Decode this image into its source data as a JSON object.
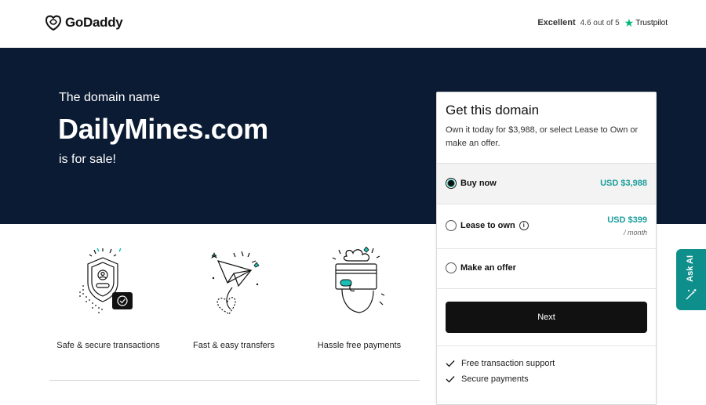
{
  "header": {
    "brand": "GoDaddy",
    "rating_word": "Excellent",
    "rating_score": "4.6 out of 5",
    "rating_provider": "Trustpilot"
  },
  "hero": {
    "pre": "The domain name",
    "domain": "DailyMines.com",
    "post": "is for sale!"
  },
  "features": [
    {
      "label": "Safe & secure transactions",
      "icon": "shield-icon"
    },
    {
      "label": "Fast & easy transfers",
      "icon": "paper-plane-icon"
    },
    {
      "label": "Hassle free payments",
      "icon": "credit-card-icon"
    }
  ],
  "card": {
    "title": "Get this domain",
    "description": "Own it today for $3,988, or select Lease to Own or make an offer.",
    "options": {
      "buy": {
        "label": "Buy now",
        "price": "USD $3,988",
        "selected": true
      },
      "lease": {
        "label": "Lease to own",
        "price": "USD $399",
        "period": "/ month"
      },
      "offer": {
        "label": "Make an offer"
      }
    },
    "next_label": "Next",
    "benefits": [
      "Free transaction support",
      "Secure payments"
    ]
  },
  "ask_ai": {
    "label": "Ask AI"
  },
  "colors": {
    "hero_bg": "#0a1b33",
    "accent_teal": "#1b9e9b",
    "ask_ai_bg": "#0f8f8b",
    "button_bg": "#111111",
    "trustpilot_green": "#00b67a"
  }
}
